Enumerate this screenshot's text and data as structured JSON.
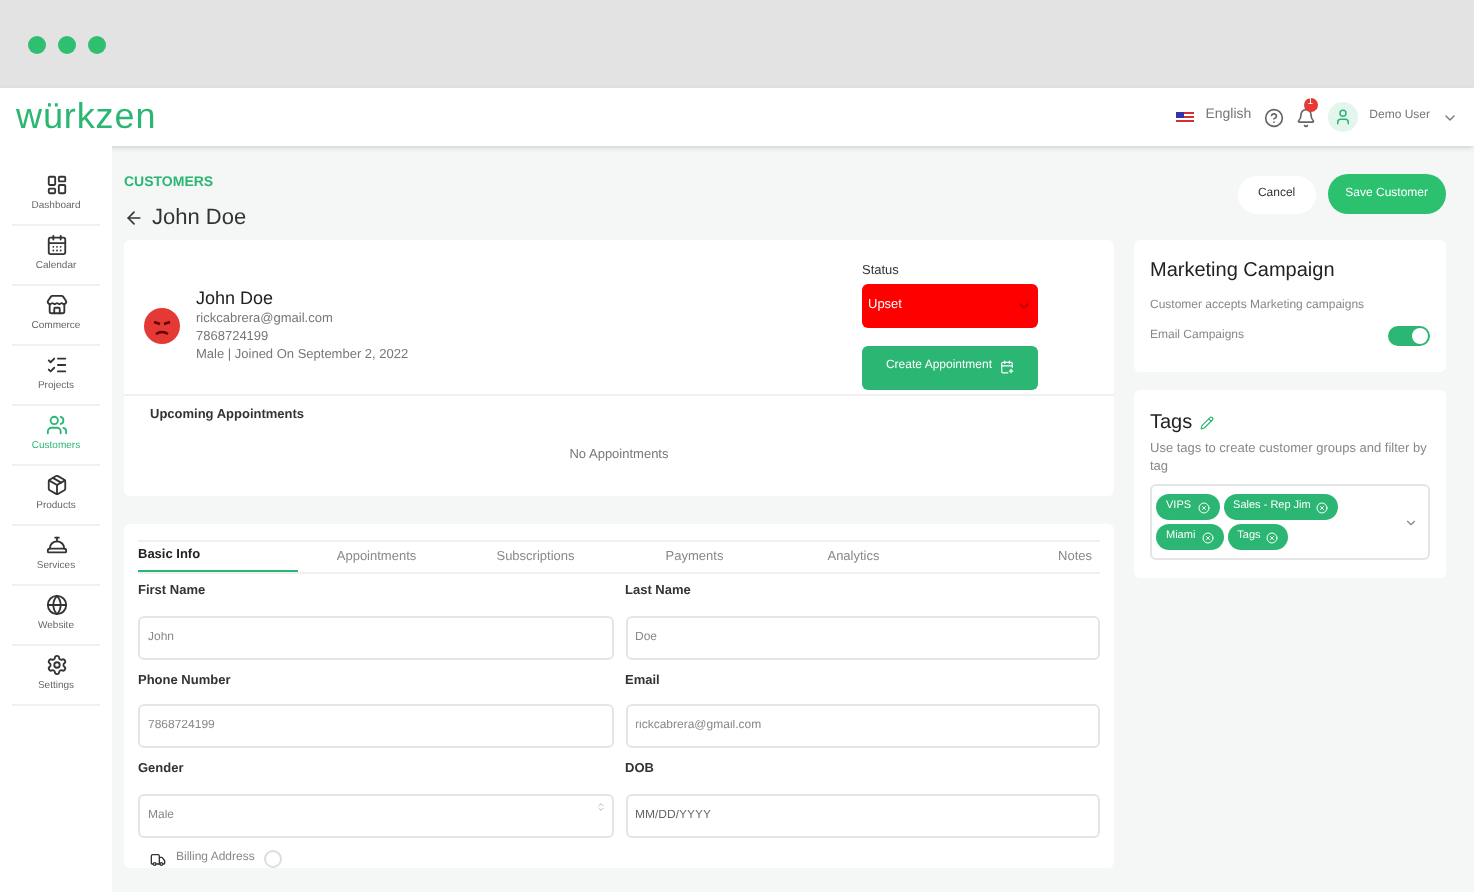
{
  "logo": "würkzen",
  "header": {
    "language": "English",
    "notifications": "1",
    "user": "Demo User"
  },
  "sidebar": {
    "items": [
      {
        "label": "Dashboard",
        "selected": false
      },
      {
        "label": "Calendar",
        "selected": false
      },
      {
        "label": "Commerce",
        "selected": false
      },
      {
        "label": "Projects",
        "selected": false
      },
      {
        "label": "Customers",
        "selected": true
      },
      {
        "label": "Products",
        "selected": false
      },
      {
        "label": "Services",
        "selected": false
      },
      {
        "label": "Website",
        "selected": false
      },
      {
        "label": "Settings",
        "selected": false
      }
    ]
  },
  "breadcrumb": "CUSTOMERS",
  "title": "John Doe",
  "actions": {
    "cancel": "Cancel",
    "save": "Save Customer"
  },
  "customer": {
    "name": "John Doe",
    "email": "rickcabrera@gmail.com",
    "phone": "7868724199",
    "meta": "Male | Joined On September 2, 2022",
    "status_label": "Status",
    "status": "Upset",
    "create_button": "Create Appointment",
    "appointments_title": "Upcoming Appointments",
    "appointments_empty": "No Appointments"
  },
  "marketing": {
    "title": "Marketing Campaign",
    "description": "Customer accepts Marketing campaigns",
    "toggle_label": "Email Campaigns",
    "on": true
  },
  "tags": {
    "title": "Tags",
    "description": "Use tags to create customer groups and filter by tag",
    "items": [
      "VIPS",
      "Sales - Rep Jim",
      "Miami",
      "Tags"
    ]
  },
  "form": {
    "tabs": [
      {
        "label": "Basic Info",
        "selected": true
      },
      {
        "label": "Appointments",
        "selected": false
      },
      {
        "label": "Subscriptions",
        "selected": false
      },
      {
        "label": "Payments",
        "selected": false
      },
      {
        "label": "Analytics",
        "selected": false
      },
      {
        "label": "Notes",
        "selected": false
      }
    ],
    "fields": [
      {
        "kind": "text",
        "label": "First Name",
        "value": "John"
      },
      {
        "kind": "text",
        "label": "Last Name",
        "value": "Doe"
      },
      {
        "kind": "text",
        "label": "Phone Number",
        "value": "7868724199"
      },
      {
        "kind": "text",
        "label": "Email",
        "value": "rickcabrera@gmail.com"
      },
      {
        "kind": "select",
        "label": "Gender",
        "value": "Male"
      },
      {
        "kind": "date",
        "label": "DOB",
        "placeholder": "MM/DD/YYYY"
      }
    ],
    "billing": {
      "label": "Billing Address",
      "checked": false
    }
  }
}
